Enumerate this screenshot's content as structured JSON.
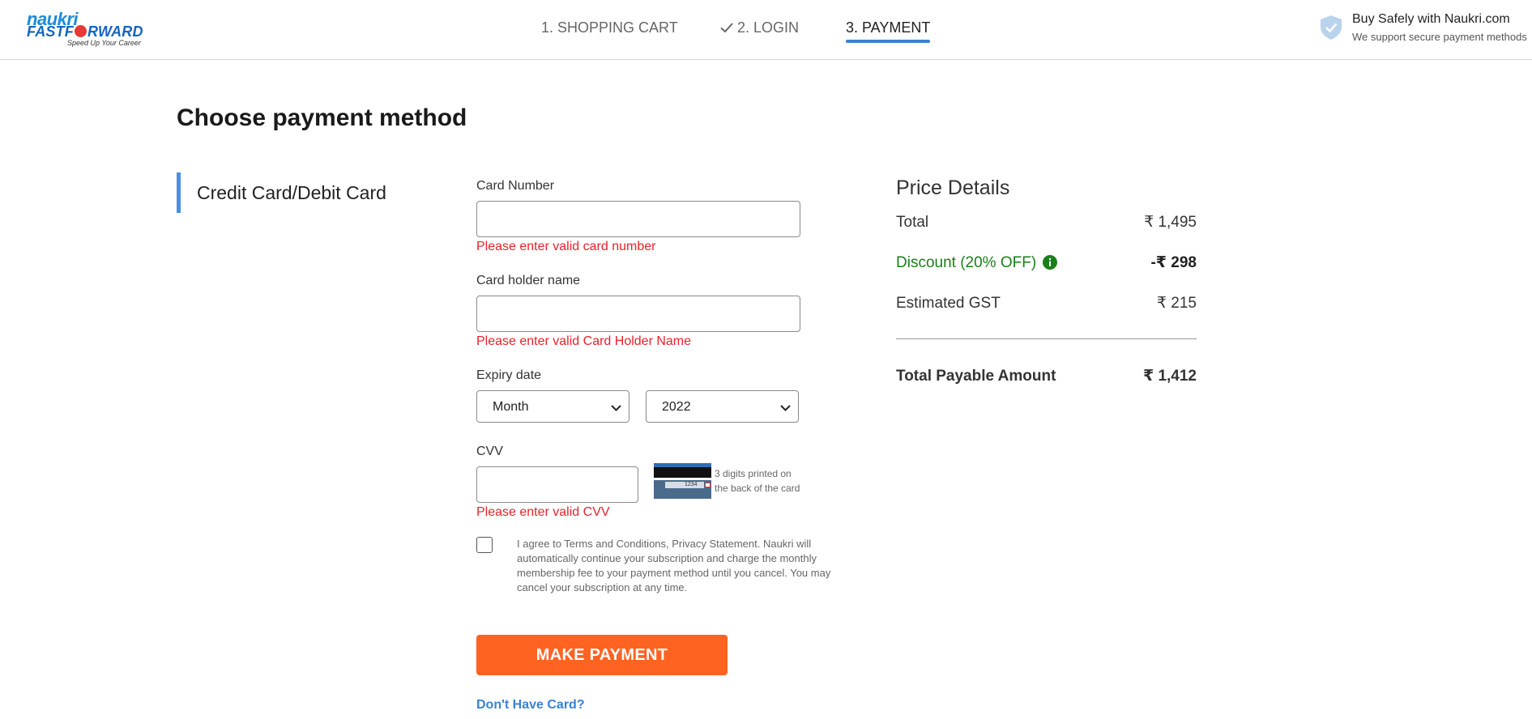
{
  "header": {
    "logo": {
      "line1": "naukri",
      "line2_a": "FASTF",
      "line2_b": "RWARD",
      "tagline": "Speed Up Your Career"
    },
    "steps": [
      {
        "label": "1. SHOPPING CART",
        "state": "pending"
      },
      {
        "label": "2. LOGIN",
        "state": "done",
        "icon": "check-icon"
      },
      {
        "label": "3. PAYMENT",
        "state": "active"
      }
    ],
    "secure": {
      "title": "Buy Safely with Naukri.com",
      "subtitle": "We support secure payment methods",
      "icon": "shield-check-icon"
    }
  },
  "page_title": "Choose payment method",
  "method_tab": "Credit Card/Debit Card",
  "form": {
    "card_number": {
      "label": "Card Number",
      "value": "",
      "error": "Please enter valid card number"
    },
    "card_holder": {
      "label": "Card holder name",
      "value": "",
      "error": "Please enter valid Card Holder Name"
    },
    "expiry": {
      "label": "Expiry date",
      "month": "Month",
      "year": "2022"
    },
    "cvv": {
      "label": "CVV",
      "value": "",
      "error": "Please enter valid CVV",
      "hint": "3 digits printed on the back of the card",
      "card_code": "1234"
    },
    "agree_text": "I agree to Terms and Conditions, Privacy Statement. Naukri will automatically continue your subscription and charge the monthly membership fee to your payment method until you cancel. You may cancel your subscription at any time.",
    "agree_checked": false,
    "submit_label": "MAKE PAYMENT",
    "no_card_link": "Don't Have Card?"
  },
  "price_details": {
    "title": "Price Details",
    "total": {
      "label": "Total",
      "value": "₹ 1,495"
    },
    "discount": {
      "label": "Discount (20% OFF)",
      "value": "-₹ 298"
    },
    "gst": {
      "label": "Estimated GST",
      "value": "₹ 215"
    },
    "payable": {
      "label": "Total Payable Amount",
      "value": "₹ 1,412"
    }
  },
  "colors": {
    "accent": "#3b7fd6",
    "button": "#fe6321",
    "error": "#e8212b",
    "discount": "#1a7f1a"
  }
}
